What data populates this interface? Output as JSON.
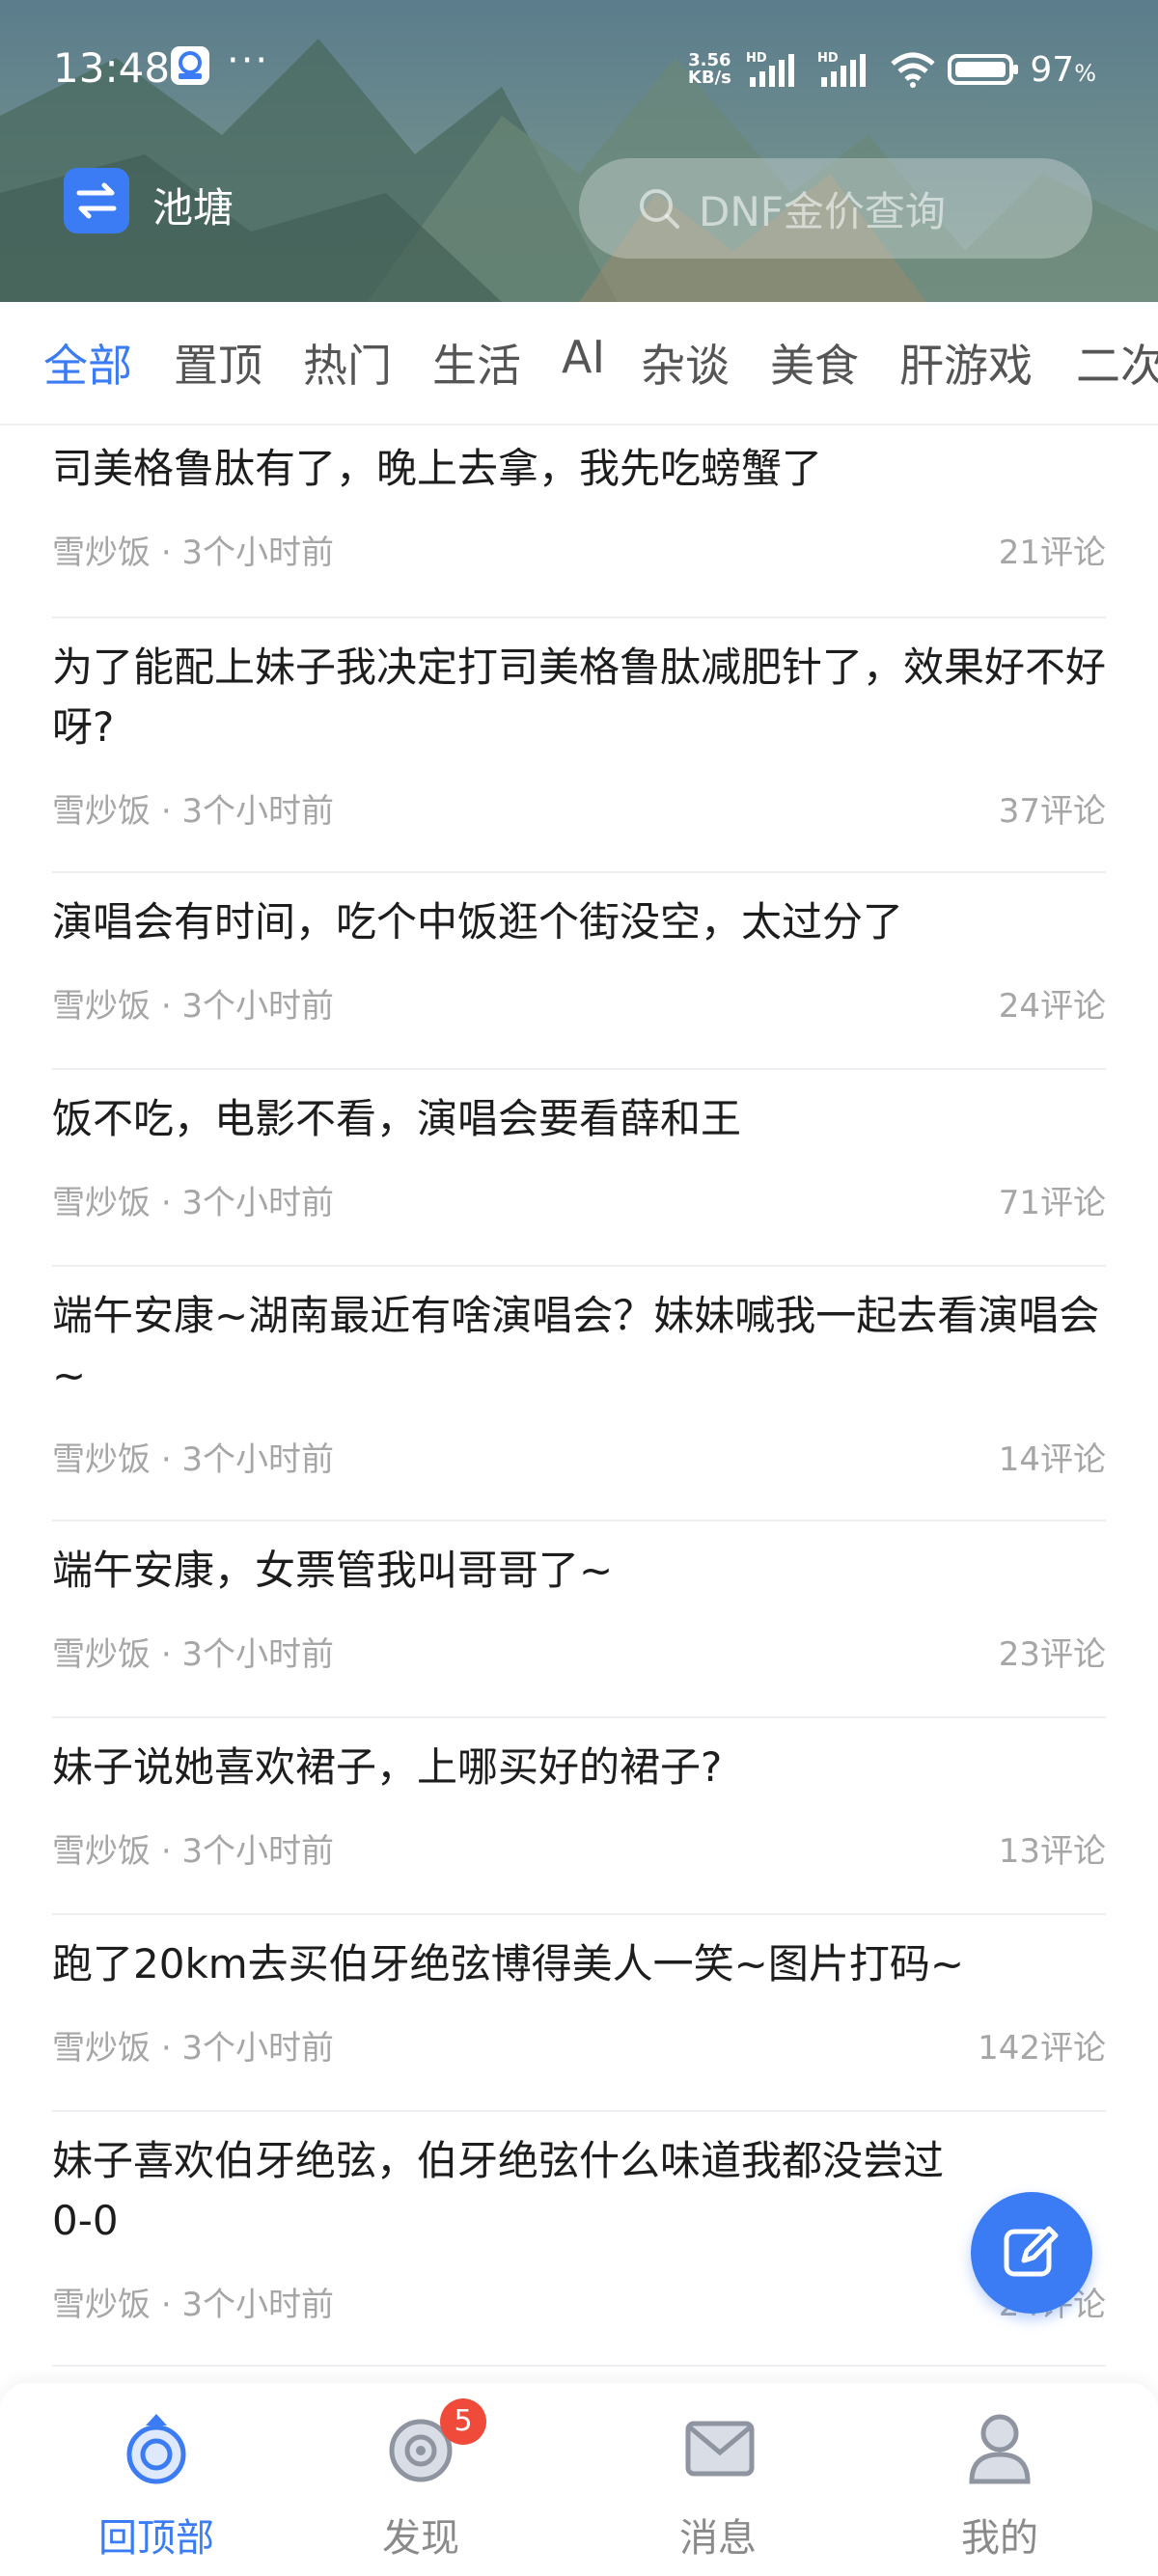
{
  "status_bar": {
    "time": "13:48",
    "net_speed_value": "3.56",
    "net_speed_unit": "KB/s",
    "signal_1_label": "HD",
    "signal_2_label": "HD",
    "battery_percent": "97",
    "battery_unit": "%"
  },
  "header": {
    "title": "池塘",
    "search_placeholder": "DNF金价查询"
  },
  "tabs": [
    "全部",
    "置顶",
    "热门",
    "生活",
    "AI",
    "杂谈",
    "美食",
    "肝游戏",
    "二次"
  ],
  "posts": [
    {
      "title": "司美格鲁肽有了，晚上去拿，我先吃螃蟹了",
      "author": "雪炒饭",
      "time": "· 3个小时前",
      "comments": "21评论"
    },
    {
      "title": "为了能配上妹子我决定打司美格鲁肽减肥针了，效果好不好呀?",
      "author": "雪炒饭",
      "time": "· 3个小时前",
      "comments": "37评论"
    },
    {
      "title": "演唱会有时间，吃个中饭逛个街没空，太过分了",
      "author": "雪炒饭",
      "time": "· 3个小时前",
      "comments": "24评论"
    },
    {
      "title": "饭不吃，电影不看，演唱会要看薛和王",
      "author": "雪炒饭",
      "time": "· 3个小时前",
      "comments": "71评论"
    },
    {
      "title": "端午安康~湖南最近有啥演唱会？妹妹喊我一起去看演唱会~",
      "author": "雪炒饭",
      "time": "· 3个小时前",
      "comments": "14评论"
    },
    {
      "title": "端午安康，女票管我叫哥哥了~",
      "author": "雪炒饭",
      "time": "· 3个小时前",
      "comments": "23评论"
    },
    {
      "title": "妹子说她喜欢裙子，上哪买好的裙子?",
      "author": "雪炒饭",
      "time": "· 3个小时前",
      "comments": "13评论"
    },
    {
      "title": "跑了20km去买伯牙绝弦博得美人一笑~图片打码~",
      "author": "雪炒饭",
      "time": "· 3个小时前",
      "comments": "142评论"
    },
    {
      "title": "妹子喜欢伯牙绝弦，伯牙绝弦什么味道我都没尝过0-0",
      "author": "雪炒饭",
      "time": "· 3个小时前",
      "comments": "24评论"
    }
  ],
  "bottom_nav": {
    "items": [
      {
        "label": "回顶部",
        "icon": "top-icon"
      },
      {
        "label": "发现",
        "icon": "discover-icon",
        "badge": "5"
      },
      {
        "label": "消息",
        "icon": "mail-icon"
      },
      {
        "label": "我的",
        "icon": "profile-icon"
      }
    ]
  },
  "colors": {
    "accent": "#3b7cf5",
    "badge": "#f04b3a",
    "meta_text": "#a6a6a6"
  }
}
